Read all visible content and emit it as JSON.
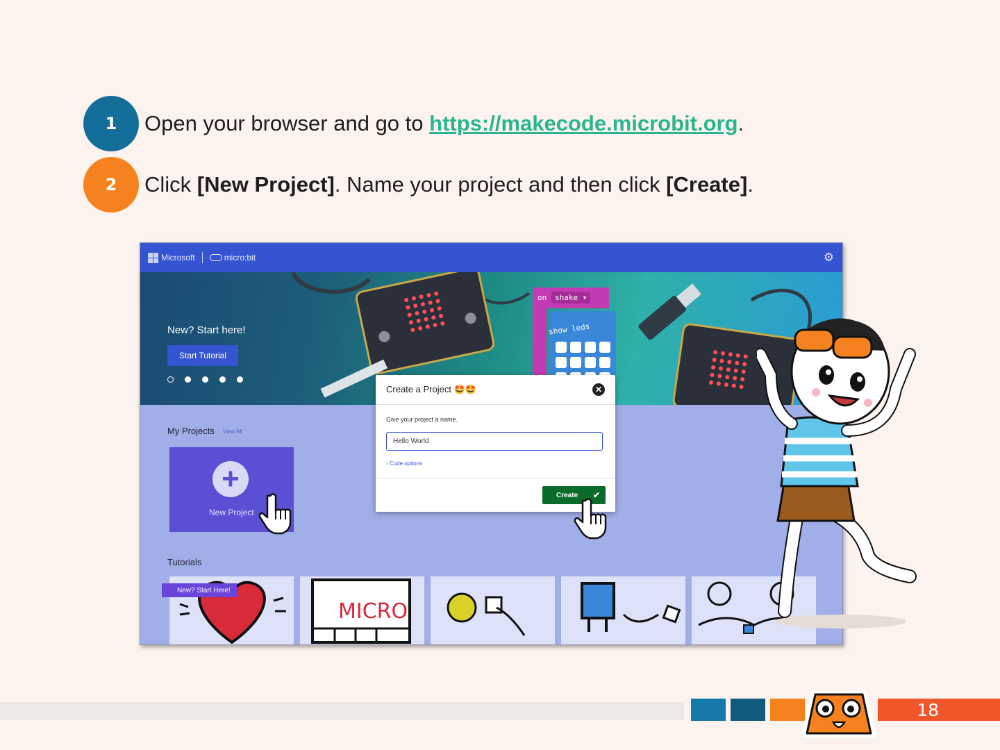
{
  "steps": [
    {
      "number": "1",
      "color": "#156e9a",
      "text_before": "Open your browser and go to ",
      "link": "https://makecode.microbit.org",
      "text_after": "."
    },
    {
      "number": "2",
      "color": "#f5821f",
      "text_before": "Click ",
      "bold1": "[New Project]",
      "text_mid": ". Name your project and then click ",
      "bold2": "[Create]",
      "text_after": "."
    }
  ],
  "screenshot": {
    "topbar": {
      "brand": "Microsoft",
      "product": "micro:bit"
    },
    "hero": {
      "title": "New? Start here!",
      "button": "Start Tutorial",
      "blocks": {
        "event": "on",
        "event_arg": "shake ▾",
        "action": "show leds"
      }
    },
    "my_projects": {
      "label": "My Projects",
      "view_all": "View All",
      "new_project": "New Project"
    },
    "tutorials": {
      "label": "Tutorials",
      "badge": "New? Start Here!"
    },
    "dialog": {
      "title": "Create a Project 🤩🤩",
      "prompt": "Give your project a name.",
      "input_value": "Hello World",
      "code_options": "Code options",
      "create": "Create"
    }
  },
  "footer": {
    "page_number": "18",
    "colors": [
      "#1479a8",
      "#105a7e",
      "#f5821f",
      "#f0562a"
    ]
  }
}
